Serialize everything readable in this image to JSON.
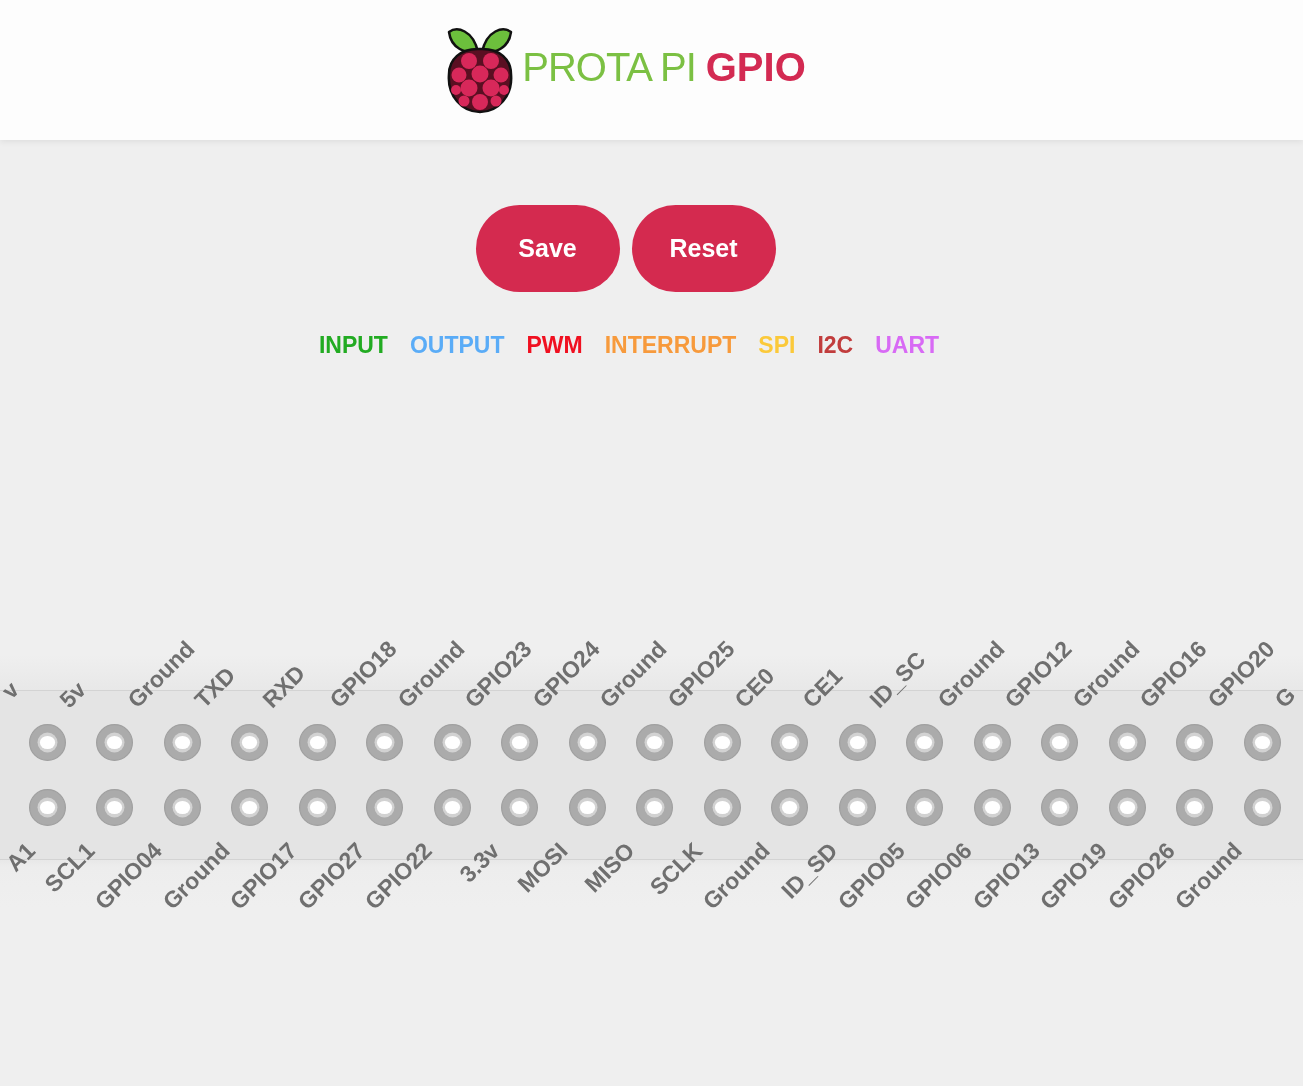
{
  "brand": {
    "name": "PROTA PI",
    "product": "GPIO"
  },
  "buttons": [
    {
      "label": "Save"
    },
    {
      "label": "Reset"
    }
  ],
  "legend": [
    {
      "label": "INPUT",
      "color": "#22ab22"
    },
    {
      "label": "OUTPUT",
      "color": "#5aacf7"
    },
    {
      "label": "PWM",
      "color": "#f01020"
    },
    {
      "label": "INTERRUPT",
      "color": "#f79a3c"
    },
    {
      "label": "SPI",
      "color": "#fbc93a"
    },
    {
      "label": "I2C",
      "color": "#c13c3c"
    },
    {
      "label": "UART",
      "color": "#d86af5"
    }
  ],
  "pin_header": {
    "top_labels": [
      "v",
      "5v",
      "Ground",
      "TXD",
      "RXD",
      "GPIO18",
      "Ground",
      "GPIO23",
      "GPIO24",
      "Ground",
      "GPIO25",
      "CE0",
      "CE1",
      "ID_SC",
      "Ground",
      "GPIO12",
      "Ground",
      "GPIO16",
      "GPIO20",
      "G"
    ],
    "bottom_labels": [
      "A1",
      "SCL1",
      "GPIO04",
      "Ground",
      "GPIO17",
      "GPIO27",
      "GPIO22",
      "3.3v",
      "MOSI",
      "MISO",
      "SCLK",
      "Ground",
      "ID_SD",
      "GPIO05",
      "GPIO06",
      "GPIO13",
      "GPIO19",
      "GPIO26",
      "Ground"
    ]
  }
}
